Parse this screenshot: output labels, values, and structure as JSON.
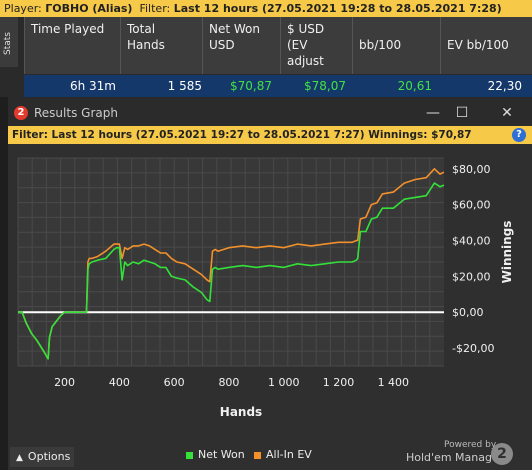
{
  "topbar": {
    "player_label": "Player:",
    "player_value": "ГОВНО (Alias)",
    "filter_label": "Filter:",
    "filter_value": "Last 12 hours (27.05.2021 19:28 to 28.05.2021 7:28)"
  },
  "stats_tab": "Stats",
  "table": {
    "headers": [
      "Time Played",
      "Total Hands",
      "Net Won USD",
      "$ USD (EV adjust",
      "bb/100",
      "EV bb/100"
    ],
    "row": [
      "6h 31m",
      "1 585",
      "$70,87",
      "$78,07",
      "20,61",
      "22,30"
    ]
  },
  "window": {
    "title": "Results Graph",
    "logo_digit": "2",
    "buttons": {
      "minimize": "—",
      "maximize": "☐",
      "close": "✕"
    },
    "filter_text": "Filter: Last 12 hours (27.05.2021 19:27 to 28.05.2021 7:27)  Winnings: $70,87",
    "help": "?"
  },
  "chart_data": {
    "type": "line",
    "xlabel": "Hands",
    "ylabel": "Winnings",
    "xlim": [
      30,
      1585
    ],
    "ylim": [
      -30,
      86
    ],
    "x_ticks": [
      200,
      400,
      600,
      800,
      1000,
      1200,
      1400
    ],
    "x_tick_labels": [
      "200",
      "400",
      "600",
      "800",
      "1 000",
      "1 200",
      "1 400"
    ],
    "y_ticks": [
      -20,
      0,
      20,
      40,
      60,
      80
    ],
    "y_tick_labels": [
      "-$20,00",
      "$0,00",
      "$20,00",
      "$40,00",
      "$60,00",
      "$80,00"
    ],
    "colors": {
      "net_won": "#33e13a",
      "all_in_ev": "#f2912c",
      "zero_line": "#ffffff",
      "grid": "#4a4a4a"
    },
    "series": [
      {
        "name": "Net Won",
        "color": "#33e13a",
        "x": [
          30,
          45,
          60,
          80,
          100,
          125,
          140,
          145,
          155,
          165,
          185,
          200,
          215,
          230,
          250,
          260,
          280,
          285,
          290,
          300,
          320,
          350,
          380,
          390,
          400,
          410,
          420,
          430,
          450,
          470,
          490,
          510,
          530,
          550,
          570,
          590,
          610,
          640,
          670,
          700,
          720,
          730,
          740,
          750,
          760,
          800,
          850,
          900,
          950,
          1000,
          1050,
          1100,
          1150,
          1200,
          1250,
          1265,
          1270,
          1280,
          1300,
          1320,
          1340,
          1360,
          1400,
          1440,
          1480,
          1520,
          1550,
          1570,
          1585
        ],
        "y": [
          0,
          0,
          -6,
          -12,
          -16,
          -22,
          -26,
          -14,
          -8,
          -6,
          -2,
          0,
          0,
          0,
          0,
          0,
          0,
          24,
          27,
          28,
          29,
          30,
          35,
          36,
          36,
          18,
          28,
          26,
          28,
          27,
          29,
          28,
          27,
          25,
          25,
          20,
          19,
          18,
          14,
          11,
          7,
          6,
          24,
          25,
          24,
          25,
          26,
          25,
          26,
          25,
          27,
          26,
          27,
          28,
          28,
          29,
          30,
          45,
          45,
          52,
          53,
          58,
          58,
          63,
          64,
          65,
          72,
          70,
          70.87
        ]
      },
      {
        "name": "All-In EV",
        "color": "#f2912c",
        "x": [
          30,
          45,
          60,
          80,
          100,
          125,
          140,
          145,
          155,
          165,
          185,
          200,
          215,
          230,
          250,
          260,
          280,
          285,
          290,
          300,
          320,
          350,
          380,
          390,
          400,
          410,
          420,
          430,
          450,
          470,
          490,
          510,
          530,
          550,
          570,
          590,
          610,
          640,
          670,
          700,
          720,
          730,
          740,
          750,
          760,
          800,
          850,
          900,
          950,
          1000,
          1050,
          1100,
          1150,
          1200,
          1250,
          1265,
          1270,
          1280,
          1300,
          1320,
          1340,
          1360,
          1400,
          1440,
          1480,
          1520,
          1550,
          1570,
          1585
        ],
        "y": [
          0,
          0,
          -6,
          -12,
          -16,
          -22,
          -26,
          -14,
          -8,
          -6,
          -2,
          0,
          0,
          0,
          0,
          0,
          0,
          28,
          30,
          30,
          31,
          34,
          38,
          38,
          38,
          30,
          36,
          35,
          37,
          37,
          38,
          37,
          35,
          33,
          33,
          30,
          28,
          27,
          24,
          21,
          18,
          17,
          34,
          35,
          34,
          36,
          37,
          36,
          37,
          36,
          38,
          37,
          38,
          39,
          39,
          40,
          40,
          52,
          53,
          60,
          61,
          66,
          67,
          72,
          74,
          75,
          80,
          77,
          78.07
        ]
      }
    ]
  },
  "footer": {
    "options_label": "Options",
    "legend": [
      {
        "label": "Net Won",
        "color": "#33e13a"
      },
      {
        "label": "All-In EV",
        "color": "#f2912c"
      }
    ],
    "powered_by": "Powered by",
    "brand": "Hold'em Manager",
    "brand_digit": "2"
  }
}
